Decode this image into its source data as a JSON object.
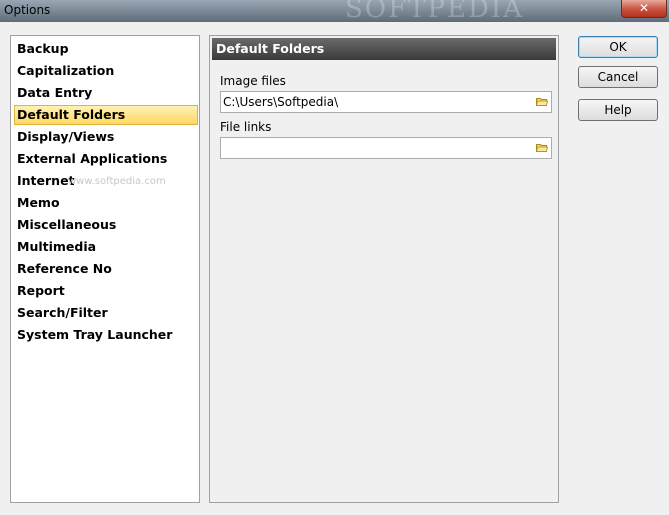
{
  "window": {
    "title": "Options",
    "watermark": "SOFTPEDIA",
    "close_label": "✕"
  },
  "categories": [
    {
      "label": "Backup"
    },
    {
      "label": "Capitalization"
    },
    {
      "label": "Data Entry"
    },
    {
      "label": "Default Folders",
      "selected": true
    },
    {
      "label": "Display/Views"
    },
    {
      "label": "External Applications"
    },
    {
      "label": "Internet"
    },
    {
      "label": "Memo"
    },
    {
      "label": "Miscellaneous"
    },
    {
      "label": "Multimedia"
    },
    {
      "label": "Reference No"
    },
    {
      "label": "Report"
    },
    {
      "label": "Search/Filter"
    },
    {
      "label": "System Tray Launcher"
    }
  ],
  "list_watermark": "www.softpedia.com",
  "panel": {
    "title": "Default Folders",
    "fields": {
      "image_files": {
        "label": "Image files",
        "value": "C:\\Users\\Softpedia\\"
      },
      "file_links": {
        "label": "File links",
        "value": ""
      }
    }
  },
  "buttons": {
    "ok": "OK",
    "cancel": "Cancel",
    "help": "Help"
  },
  "colors": {
    "selection_top": "#fff1b5",
    "selection_bottom": "#ffd863",
    "header_bg": "#3a3a3a"
  }
}
